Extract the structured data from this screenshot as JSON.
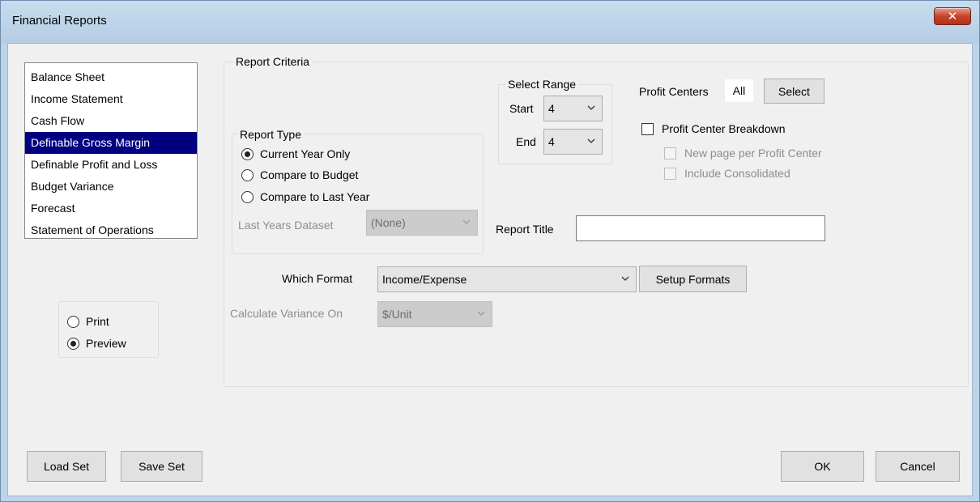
{
  "window": {
    "title": "Financial Reports",
    "close_glyph": "✕"
  },
  "report_list": {
    "items": [
      {
        "label": "Balance Sheet"
      },
      {
        "label": "Income Statement"
      },
      {
        "label": "Cash Flow"
      },
      {
        "label": "Definable Gross Margin",
        "selected": true
      },
      {
        "label": "Definable Profit and Loss"
      },
      {
        "label": "Budget Variance"
      },
      {
        "label": "Forecast"
      },
      {
        "label": "Statement of Operations"
      }
    ]
  },
  "output": {
    "print_label": "Print",
    "preview_label": "Preview",
    "selected": "Preview"
  },
  "criteria": {
    "label": "Report Criteria",
    "report_type": {
      "label": "Report Type",
      "options": [
        "Current Year Only",
        "Compare to Budget",
        "Compare to Last Year"
      ],
      "selected": "Current Year Only",
      "last_years_dataset_label": "Last Years Dataset",
      "last_years_dataset_value": "(None)"
    },
    "select_range": {
      "label": "Select Range",
      "start_label": "Start",
      "start_value": "4",
      "end_label": "End",
      "end_value": "4"
    },
    "profit_centers": {
      "label": "Profit Centers",
      "value": "All",
      "select_button": "Select",
      "breakdown_label": "Profit Center Breakdown",
      "new_page_label": "New page per Profit Center",
      "include_consolidated_label": "Include Consolidated"
    },
    "report_title": {
      "label": "Report Title",
      "value": ""
    },
    "which_format": {
      "label": "Which Format",
      "value": "Income/Expense",
      "setup_button": "Setup Formats"
    },
    "calculate_variance": {
      "label": "Calculate Variance On",
      "value": "$/Unit"
    }
  },
  "footer": {
    "load_set": "Load Set",
    "save_set": "Save Set",
    "ok": "OK",
    "cancel": "Cancel"
  }
}
